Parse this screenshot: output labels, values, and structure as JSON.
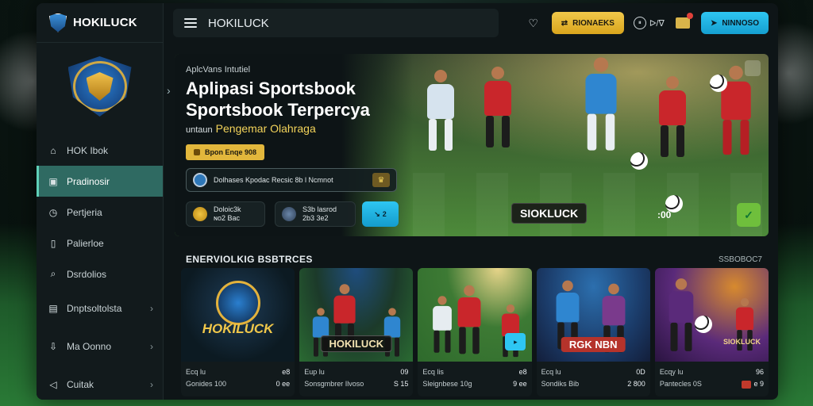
{
  "brand": {
    "name": "HOKILUCK"
  },
  "header": {
    "title": "HOKILUCK",
    "btn_primary": "RIONAEKS",
    "timer": "ᐅ/ᐁ",
    "btn_secondary": "NINNOSO"
  },
  "sidebar": {
    "items": [
      {
        "label": "HOK Ibok",
        "icon": "home-icon"
      },
      {
        "label": "Pradinosir",
        "icon": "calendar-icon",
        "active": true
      },
      {
        "label": "Pertjeria",
        "icon": "clock-icon"
      },
      {
        "label": "Palierloe",
        "icon": "bookmark-icon"
      },
      {
        "label": "Dsrdolios",
        "icon": "search-icon"
      },
      {
        "label": "Dnptsoltolsta",
        "icon": "wallet-icon",
        "chevron": true
      },
      {
        "label": "Ma Oonno",
        "icon": "download-icon",
        "chevron": true
      },
      {
        "label": "Cuitak",
        "icon": "share-icon",
        "chevron": true
      }
    ]
  },
  "hero": {
    "subtitle": "AplcVans Intutiel",
    "title_line1": "Aplipasi Sportsbook",
    "title_line2": "Sportsbook Terpercya",
    "tagline_prefix": "untaun",
    "tagline": "Pengemar Olahraga",
    "chip": "Bpon Enqe 908",
    "promo": "Dolhases Kpodac Recsic 8b l Ncmnot",
    "stat1_line1": "Doloic3k",
    "stat1_line2": "ɴo2 Bac",
    "stat2_line1": "S3b lasrod",
    "stat2_line2": "2b3 3e2",
    "cta": "2",
    "badge": "SIOKLUCK",
    "score": ":00"
  },
  "section": {
    "title": "ENERVIOLKIG BSBTRCES",
    "link": "SSBOBOC7"
  },
  "cards": [
    {
      "label": "HOKILUCK",
      "meta1": "Ecq lu",
      "meta1_val": "e8",
      "meta2": "Gonides  100",
      "meta2_val": "0 ee"
    },
    {
      "label": "HOKILUCK",
      "meta1": "Eup lu",
      "meta1_val": "09",
      "meta2": "Sonsgmbrer Ilvoso",
      "meta2_val": "S 15"
    },
    {
      "label": "",
      "meta1": "Ecq lis",
      "meta1_val": "e8",
      "meta2": "Sleignbese 10g",
      "meta2_val": "9 ee"
    },
    {
      "label": "RGK NBN",
      "meta1": "Ecq lu",
      "meta1_val": "0D",
      "meta2": "Sondiks  Bib",
      "meta2_val": "2 800"
    },
    {
      "label": "SIOKLUCK",
      "meta1": "Ecqy lu",
      "meta1_val": "96",
      "meta2": "Pantecles  0S",
      "meta2_val": "e 9"
    }
  ]
}
